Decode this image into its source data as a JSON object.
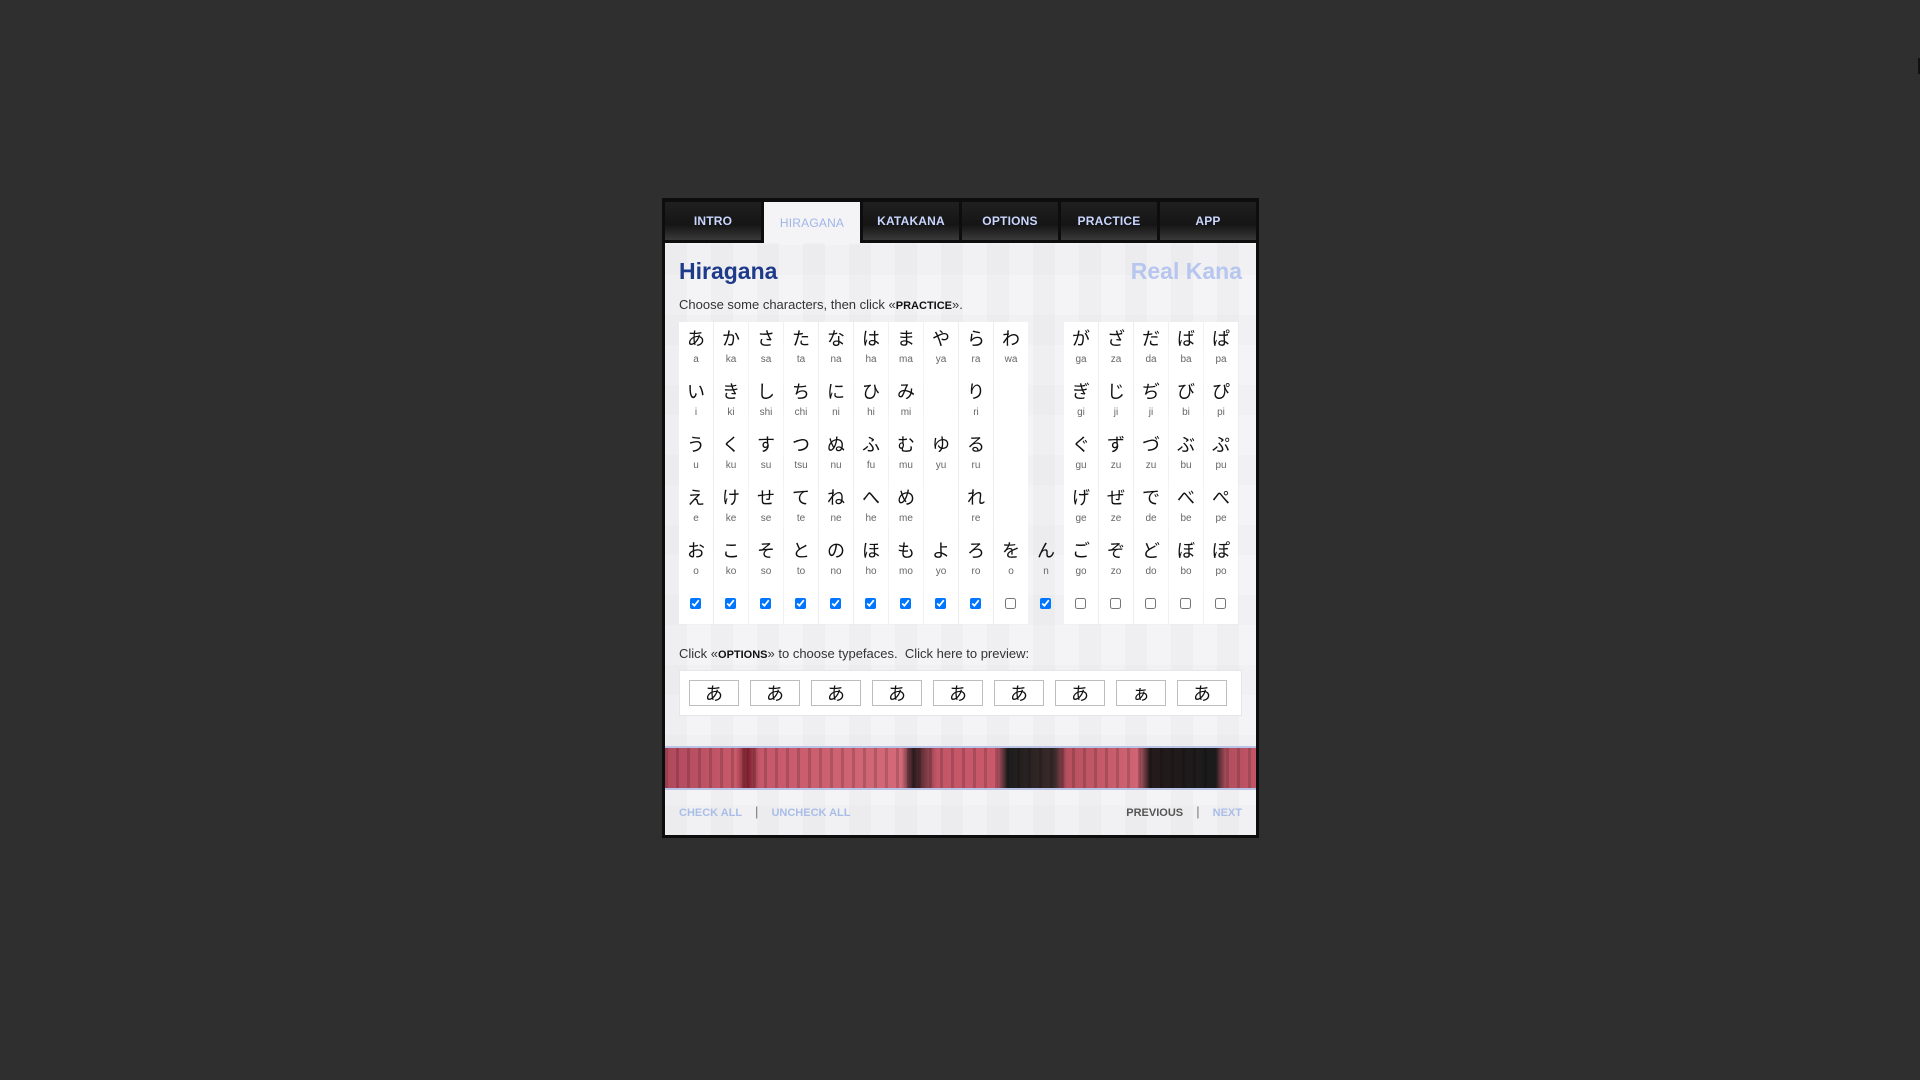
{
  "tabs": [
    "INTRO",
    "HIRAGANA",
    "KATAKANA",
    "OPTIONS",
    "PRACTICE",
    "APP"
  ],
  "active_tab": 1,
  "page_title": "Hiragana",
  "brand": "Real Kana",
  "instruction": {
    "pre": "Choose some characters, then click «",
    "kw": "PRACTICE",
    "post": "»."
  },
  "columns": [
    {
      "cells": [
        [
          "あ",
          "a"
        ],
        [
          "い",
          "i"
        ],
        [
          "う",
          "u"
        ],
        [
          "え",
          "e"
        ],
        [
          "お",
          "o"
        ]
      ],
      "checked": true
    },
    {
      "cells": [
        [
          "か",
          "ka"
        ],
        [
          "き",
          "ki"
        ],
        [
          "く",
          "ku"
        ],
        [
          "け",
          "ke"
        ],
        [
          "こ",
          "ko"
        ]
      ],
      "checked": true
    },
    {
      "cells": [
        [
          "さ",
          "sa"
        ],
        [
          "し",
          "shi"
        ],
        [
          "す",
          "su"
        ],
        [
          "せ",
          "se"
        ],
        [
          "そ",
          "so"
        ]
      ],
      "checked": true
    },
    {
      "cells": [
        [
          "た",
          "ta"
        ],
        [
          "ち",
          "chi"
        ],
        [
          "つ",
          "tsu"
        ],
        [
          "て",
          "te"
        ],
        [
          "と",
          "to"
        ]
      ],
      "checked": true
    },
    {
      "cells": [
        [
          "な",
          "na"
        ],
        [
          "に",
          "ni"
        ],
        [
          "ぬ",
          "nu"
        ],
        [
          "ね",
          "ne"
        ],
        [
          "の",
          "no"
        ]
      ],
      "checked": true
    },
    {
      "cells": [
        [
          "は",
          "ha"
        ],
        [
          "ひ",
          "hi"
        ],
        [
          "ふ",
          "fu"
        ],
        [
          "へ",
          "he"
        ],
        [
          "ほ",
          "ho"
        ]
      ],
      "checked": true
    },
    {
      "cells": [
        [
          "ま",
          "ma"
        ],
        [
          "み",
          "mi"
        ],
        [
          "む",
          "mu"
        ],
        [
          "め",
          "me"
        ],
        [
          "も",
          "mo"
        ]
      ],
      "checked": true
    },
    {
      "cells": [
        [
          "や",
          "ya"
        ],
        null,
        [
          "ゆ",
          "yu"
        ],
        null,
        [
          "よ",
          "yo"
        ]
      ],
      "checked": true
    },
    {
      "cells": [
        [
          "ら",
          "ra"
        ],
        [
          "り",
          "ri"
        ],
        [
          "る",
          "ru"
        ],
        [
          "れ",
          "re"
        ],
        [
          "ろ",
          "ro"
        ]
      ],
      "checked": true
    },
    {
      "cells": [
        [
          "わ",
          "wa"
        ],
        null,
        null,
        null,
        [
          "を",
          "o"
        ]
      ],
      "checked": false
    },
    {
      "cells": [
        null,
        null,
        null,
        null,
        [
          "ん",
          "n"
        ]
      ],
      "checked": true,
      "blank": true
    },
    {
      "cells": [
        [
          "が",
          "ga"
        ],
        [
          "ぎ",
          "gi"
        ],
        [
          "ぐ",
          "gu"
        ],
        [
          "げ",
          "ge"
        ],
        [
          "ご",
          "go"
        ]
      ],
      "checked": false
    },
    {
      "cells": [
        [
          "ざ",
          "za"
        ],
        [
          "じ",
          "ji"
        ],
        [
          "ず",
          "zu"
        ],
        [
          "ぜ",
          "ze"
        ],
        [
          "ぞ",
          "zo"
        ]
      ],
      "checked": false
    },
    {
      "cells": [
        [
          "だ",
          "da"
        ],
        [
          "ぢ",
          "ji"
        ],
        [
          "づ",
          "zu"
        ],
        [
          "で",
          "de"
        ],
        [
          "ど",
          "do"
        ]
      ],
      "checked": false
    },
    {
      "cells": [
        [
          "ば",
          "ba"
        ],
        [
          "び",
          "bi"
        ],
        [
          "ぶ",
          "bu"
        ],
        [
          "べ",
          "be"
        ],
        [
          "ぼ",
          "bo"
        ]
      ],
      "checked": false
    },
    {
      "cells": [
        [
          "ぱ",
          "pa"
        ],
        [
          "ぴ",
          "pi"
        ],
        [
          "ぷ",
          "pu"
        ],
        [
          "ぺ",
          "pe"
        ],
        [
          "ぽ",
          "po"
        ]
      ],
      "checked": false
    }
  ],
  "options_note": {
    "pre": "Click «",
    "kw": "OPTIONS",
    "post": "» to choose typefaces.  ",
    "preview": "Click here to preview:"
  },
  "typeface_samples": [
    "あ",
    "あ",
    "あ",
    "あ",
    "あ",
    "あ",
    "あ",
    "ぁ",
    "あ"
  ],
  "footer": {
    "check_all": "CHECK ALL",
    "uncheck_all": "UNCHECK ALL",
    "previous": "PREVIOUS",
    "next": "NEXT",
    "separator": "|"
  },
  "colors": {
    "title": "#1e3a8a",
    "brand": "#b7c6ef",
    "link_light": "#a9bde8",
    "tab_text": "#c9d6ff"
  }
}
